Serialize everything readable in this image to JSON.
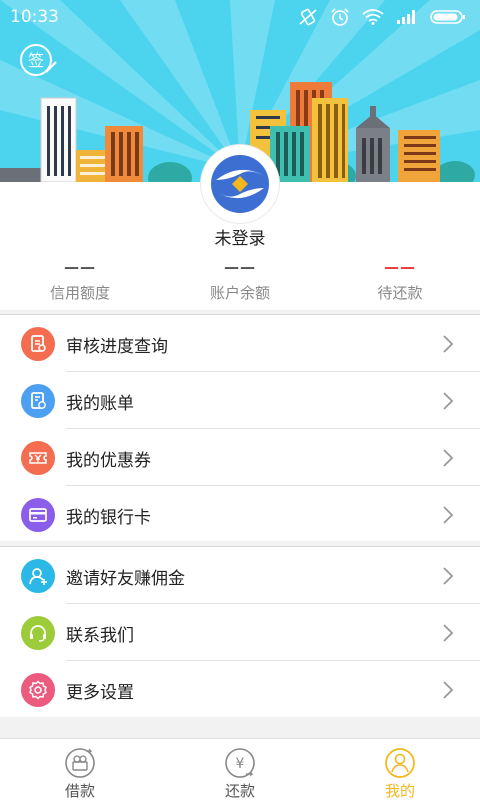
{
  "status": {
    "time": "10:33"
  },
  "header": {
    "sign_label": "签"
  },
  "profile": {
    "username": "未登录",
    "stats": [
      {
        "value": "——",
        "label": "信用额度",
        "color": "#666666"
      },
      {
        "value": "——",
        "label": "账户余额",
        "color": "#666666"
      },
      {
        "value": "——",
        "label": "待还款",
        "color": "#e4393c"
      }
    ]
  },
  "menu": {
    "group1": [
      {
        "label": "审核进度查询",
        "icon": "review-progress-icon",
        "color": "#f46d50"
      },
      {
        "label": "我的账单",
        "icon": "bill-icon",
        "color": "#4d9ff2"
      },
      {
        "label": "我的优惠券",
        "icon": "coupon-icon",
        "color": "#f46d50"
      },
      {
        "label": "我的银行卡",
        "icon": "bank-card-icon",
        "color": "#8a5ee8"
      }
    ],
    "group2": [
      {
        "label": "邀请好友赚佣金",
        "icon": "invite-friend-icon",
        "color": "#2bb8e6"
      },
      {
        "label": "联系我们",
        "icon": "headset-icon",
        "color": "#9ccc3a"
      },
      {
        "label": "更多设置",
        "icon": "settings-icon",
        "color": "#ec5a7e"
      }
    ]
  },
  "tabbar": {
    "tabs": [
      {
        "label": "借款",
        "icon": "loan-icon",
        "active": false
      },
      {
        "label": "还款",
        "icon": "repay-icon",
        "active": false
      },
      {
        "label": "我的",
        "icon": "profile-icon",
        "active": true
      }
    ],
    "active_color": "#f2b81c"
  }
}
